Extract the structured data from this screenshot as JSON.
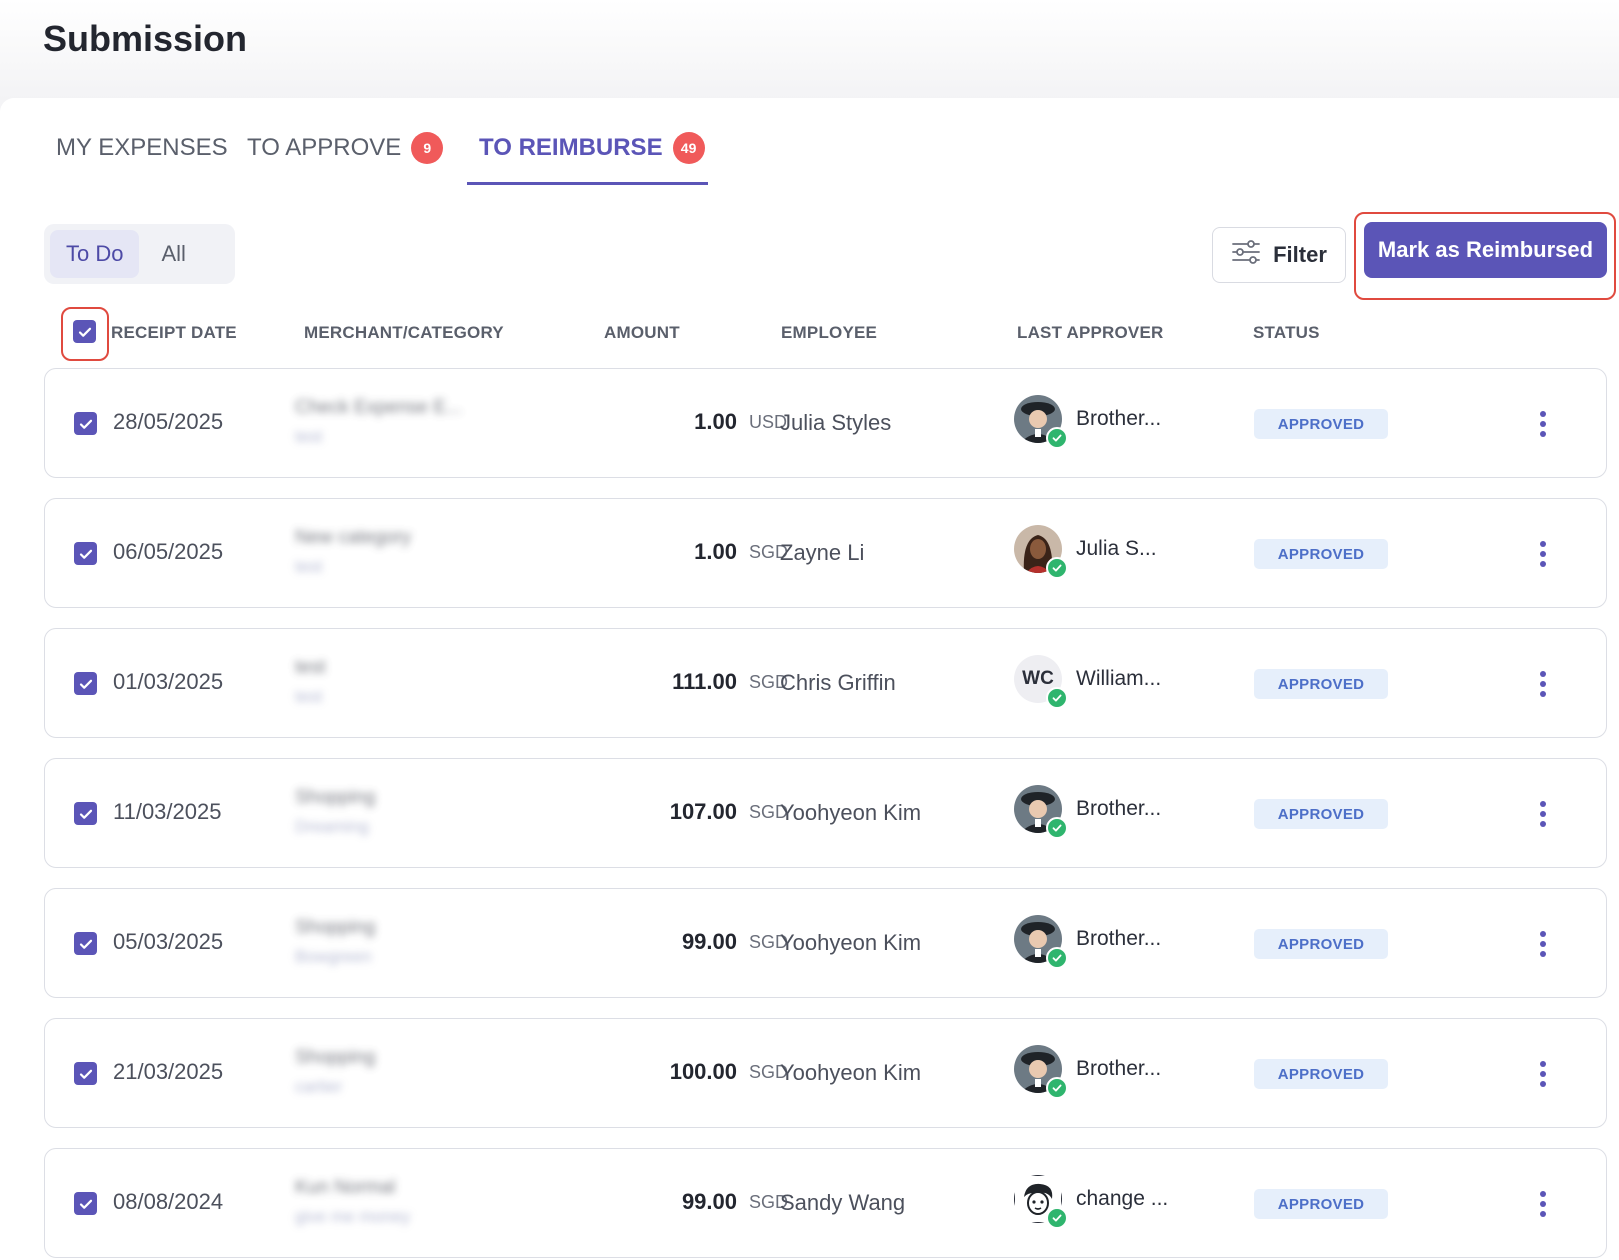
{
  "page": {
    "title": "Submission"
  },
  "tabs": [
    {
      "label": "MY EXPENSES",
      "badge": ""
    },
    {
      "label": "TO APPROVE",
      "badge": "9"
    },
    {
      "label": "TO REIMBURSE",
      "badge": "49",
      "active": true
    }
  ],
  "segmented": {
    "todo": "To Do",
    "all": "All",
    "selected": "To Do"
  },
  "toolbar": {
    "filter_label": "Filter",
    "action_label": "Mark as Reimbursed"
  },
  "table": {
    "headers": {
      "receipt_date": "RECEIPT DATE",
      "merchant": "MERCHANT/CATEGORY",
      "amount": "AMOUNT",
      "employee": "EMPLOYEE",
      "last_approver": "LAST APPROVER",
      "status": "STATUS"
    },
    "all_selected": true,
    "rows": [
      {
        "date": "28/05/2025",
        "merchant": "Check Expense E...",
        "category": "test",
        "amount": "1.00",
        "currency": "USD",
        "employee": "Julia Styles",
        "approver": "Brother...",
        "avatar": "man-cap",
        "status": "APPROVED"
      },
      {
        "date": "06/05/2025",
        "merchant": "New category",
        "category": "test",
        "amount": "1.00",
        "currency": "SGD",
        "employee": "Zayne Li",
        "approver": "Julia S...",
        "avatar": "woman",
        "status": "APPROVED"
      },
      {
        "date": "01/03/2025",
        "merchant": "test",
        "category": "test",
        "amount": "111.00",
        "currency": "SGD",
        "employee": "Chris Griffin",
        "approver": "William...",
        "avatar": "initials",
        "initials": "WC",
        "status": "APPROVED"
      },
      {
        "date": "11/03/2025",
        "merchant": "Shopping",
        "category": "Dreaming",
        "amount": "107.00",
        "currency": "SGD",
        "employee": "Yoohyeon Kim",
        "approver": "Brother...",
        "avatar": "man-cap",
        "status": "APPROVED"
      },
      {
        "date": "05/03/2025",
        "merchant": "Shopping",
        "category": "Bowgreen",
        "amount": "99.00",
        "currency": "SGD",
        "employee": "Yoohyeon Kim",
        "approver": "Brother...",
        "avatar": "man-cap",
        "status": "APPROVED"
      },
      {
        "date": "21/03/2025",
        "merchant": "Shopping",
        "category": "cartier",
        "amount": "100.00",
        "currency": "SGD",
        "employee": "Yoohyeon Kim",
        "approver": "Brother...",
        "avatar": "man-cap",
        "status": "APPROVED"
      },
      {
        "date": "08/08/2024",
        "merchant": "Kun Normal",
        "category": "give me money",
        "amount": "99.00",
        "currency": "SGD",
        "employee": "Sandy Wang",
        "approver": "change ...",
        "avatar": "cartoon",
        "status": "APPROVED"
      }
    ]
  },
  "colors": {
    "accent": "#5b55b7",
    "badge": "#f05a5a",
    "status_bg": "#e6effb",
    "status_text": "#4d6fc8",
    "verified": "#2fb56e",
    "highlight": "#e04a3f"
  },
  "icons": {
    "filter": "sliders-icon",
    "checkbox": "check-icon",
    "more": "kebab-menu-icon",
    "verified": "check-circle-icon"
  }
}
